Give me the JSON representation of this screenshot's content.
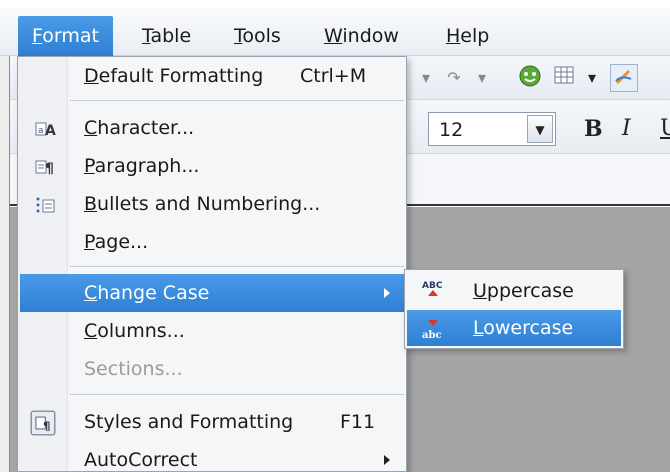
{
  "menubar": {
    "items": [
      {
        "label_mn": "F",
        "label_rest": "ormat"
      },
      {
        "label_mn": "T",
        "label_rest": "able"
      },
      {
        "label_mn": "T",
        "label_rest": "ools"
      },
      {
        "label_mn": "W",
        "label_rest": "indow"
      },
      {
        "label_mn": "H",
        "label_rest": "elp"
      }
    ]
  },
  "toolbar": {
    "font_size": "12",
    "bold_label": "B",
    "italic_label": "I",
    "underline_label": "U"
  },
  "format_menu": {
    "items": [
      {
        "mn": "D",
        "rest": "efault Formatting",
        "shortcut": "Ctrl+M"
      },
      {
        "mn": "C",
        "rest": "haracter..."
      },
      {
        "mn": "P",
        "rest": "aragraph..."
      },
      {
        "mn": "B",
        "rest": "ullets and Numbering..."
      },
      {
        "mn": "P",
        "rest": "age..."
      },
      {
        "mn": "C",
        "rest": "hange Case"
      },
      {
        "mn": "C",
        "rest": "olumns..."
      },
      {
        "mn": "",
        "rest": "Sections..."
      },
      {
        "mn": "",
        "rest": "Styles and Formatting",
        "shortcut": "F11"
      },
      {
        "mn": "",
        "rest": "AutoCorrect"
      }
    ]
  },
  "change_case_menu": {
    "items": [
      {
        "mn": "U",
        "rest": "ppercase",
        "icon_text": "ABC"
      },
      {
        "mn": "L",
        "rest": "owercase",
        "icon_text": "abc"
      }
    ]
  },
  "colors": {
    "highlight": "#3e8ee0",
    "menu_bg": "#f5f6f8",
    "disabled_text": "#9b9b9b"
  }
}
